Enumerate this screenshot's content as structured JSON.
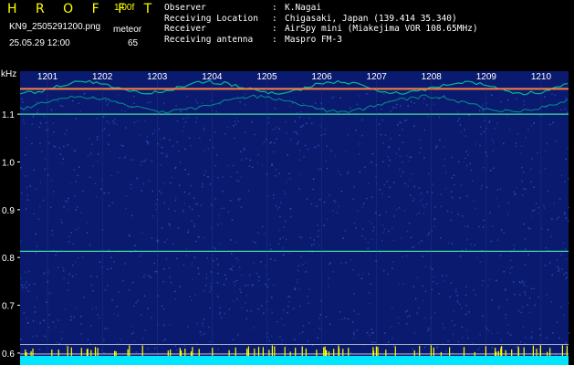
{
  "header": {
    "app_title": "H R O F F T",
    "version": "1.00f",
    "filename": "KN9_2505291200.png",
    "meteor_label": "meteor",
    "datetime": "25.05.29 12:00",
    "meteor_count": "65",
    "info": [
      {
        "key": "Observer",
        "sep": ":",
        "value": "K.Nagai"
      },
      {
        "key": "Receiving Location",
        "sep": ":",
        "value": "Chigasaki, Japan (139.414 35.340)"
      },
      {
        "key": "Receiver",
        "sep": ":",
        "value": "AirSpy mini (Miakejima VOR 108.65MHz)"
      },
      {
        "key": "Receiving antenna",
        "sep": ":",
        "value": "Maspro FM-3"
      }
    ]
  },
  "colors": {
    "background": "#000000",
    "title": "#ffff00",
    "plot_bg": "#0a1a6e",
    "noise": "#2e5bd6",
    "carrier_top": "#ff8040",
    "carrier": "#40e0a0",
    "echo": "#00e0a0",
    "floor": "#00e5ff",
    "marker": "#ffff00",
    "hline": "#ffffff"
  },
  "chart_data": {
    "type": "heatmap",
    "y_unit_label": "kHz",
    "yticks": [
      {
        "value": 1.1,
        "label": "1.1"
      },
      {
        "value": 1.0,
        "label": "1.0"
      },
      {
        "value": 0.9,
        "label": "0.9"
      },
      {
        "value": 0.8,
        "label": "0.8"
      },
      {
        "value": 0.7,
        "label": "0.7"
      },
      {
        "value": 0.6,
        "label": "0.6"
      }
    ],
    "ylim": [
      0.575,
      1.19
    ],
    "time_labels": [
      "1201",
      "1202",
      "1203",
      "1204",
      "1205",
      "1206",
      "1207",
      "1208",
      "1209",
      "1210"
    ],
    "xlim": [
      0,
      10
    ],
    "carrier_lines_khz": [
      1.153,
      1.1,
      0.813
    ],
    "white_lines_khz": [
      0.618,
      0.598
    ]
  }
}
